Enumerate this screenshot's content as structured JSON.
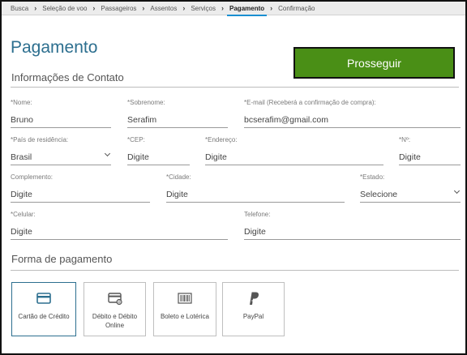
{
  "breadcrumb": {
    "items": [
      "Busca",
      "Seleção de voo",
      "Passageiros",
      "Assentos",
      "Serviços",
      "Pagamento",
      "Confirmação"
    ],
    "active_index": 5,
    "separator": "›"
  },
  "page": {
    "title": "Pagamento"
  },
  "actions": {
    "proceed_label": "Prosseguir"
  },
  "contact": {
    "title": "Informações de Contato",
    "nome": {
      "label": "*Nome:",
      "value": "Bruno"
    },
    "sobrenome": {
      "label": "*Sobrenome:",
      "value": "Serafim"
    },
    "email": {
      "label": "*E-mail (Receberá a confirmação de compra):",
      "value": "bcserafim@gmail.com"
    },
    "pais": {
      "label": "*País de residência:",
      "value": "Brasil"
    },
    "cep": {
      "label": "*CEP:",
      "value": "Digite"
    },
    "endereco": {
      "label": "*Endereço:",
      "value": "Digite"
    },
    "numero": {
      "label": "*Nº:",
      "value": "Digite"
    },
    "complemento": {
      "label": "Complemento:",
      "value": "Digite"
    },
    "cidade": {
      "label": "*Cidade:",
      "value": "Digite"
    },
    "estado": {
      "label": "*Estado:",
      "value": "Selecione"
    },
    "celular": {
      "label": "*Celular:",
      "value": "Digite"
    },
    "telefone": {
      "label": "Telefone:",
      "value": "Digite"
    }
  },
  "payment": {
    "title": "Forma de pagamento",
    "methods": [
      {
        "label": "Cartão de Crédito",
        "icon": "credit-card-icon",
        "selected": true
      },
      {
        "label": "Débito e Débito Online",
        "icon": "debit-card-icon",
        "selected": false
      },
      {
        "label": "Boleto e Lotérica",
        "icon": "barcode-icon",
        "selected": false
      },
      {
        "label": "PayPal",
        "icon": "paypal-icon",
        "selected": false
      }
    ]
  },
  "colors": {
    "accent": "#2d6f8f",
    "proceed": "#4a8f16",
    "tab_underline": "#1a8fd1"
  }
}
